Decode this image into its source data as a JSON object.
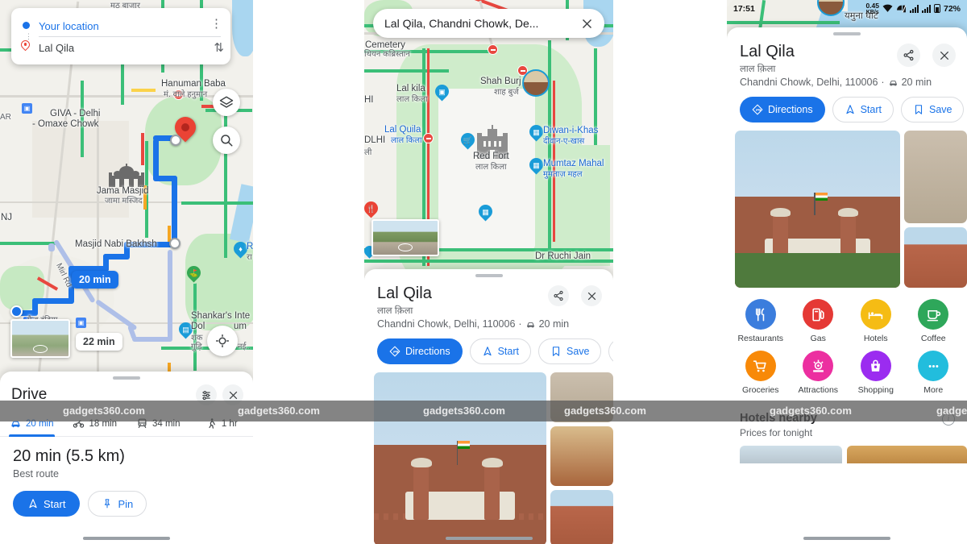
{
  "panel1": {
    "directions_card": {
      "origin": "Your location",
      "destination": "Lal Qila",
      "origin_icon": "blue-dot-icon",
      "destination_icon": "place-pin-icon",
      "menu_icon": "kebab-menu-icon",
      "swap_icon": "swap-vertical-icon"
    },
    "map_labels": [
      {
        "text": "मठ बाजार"
      },
      {
        "text": "Hanuman Baba"
      },
      {
        "text": "मं. वाले हनुमान"
      },
      {
        "text": "GIVA - Delhi"
      },
      {
        "text": "- Omaxe Chowk"
      },
      {
        "text": "Jama Masjid"
      },
      {
        "text": "जामा मस्जिद"
      },
      {
        "text": "Masjid Nabi Bakhsh"
      },
      {
        "text": "NJ"
      },
      {
        "text": "AR"
      },
      {
        "text": "Mirl Rd"
      },
      {
        "text": "फैब इंडिया"
      },
      {
        "text": "Shankar's Inte"
      },
      {
        "text": "Dol"
      },
      {
        "text": "um"
      },
      {
        "text": "शंक"
      },
      {
        "text": "गुड़ि"
      },
      {
        "text": "नई.."
      },
      {
        "text": "R"
      },
      {
        "text": "रा"
      }
    ],
    "route_chips": [
      {
        "label": "20 min",
        "primary": true
      },
      {
        "label": "22 min",
        "primary": false
      }
    ],
    "map_buttons": [
      "layers-icon",
      "search-icon",
      "recenter-icon"
    ],
    "sheet": {
      "title": "Drive",
      "options_icon": "tune-icon",
      "close_icon": "close-icon",
      "modes": [
        {
          "icon": "car-icon",
          "label": "20 min",
          "active": true
        },
        {
          "icon": "motorcycle-icon",
          "label": "18 min",
          "active": false
        },
        {
          "icon": "transit-icon",
          "label": "34 min",
          "active": false
        },
        {
          "icon": "walk-icon",
          "label": "1 hr",
          "active": false
        }
      ],
      "route_headline": "20 min (5.5 km)",
      "route_sub": "Best route",
      "start_label": "Start",
      "pin_label": "Pin"
    }
  },
  "panel2": {
    "search": {
      "value": "Lal Qila, Chandni Chowk, De...",
      "clear_icon": "close-icon"
    },
    "map_labels": [
      {
        "text": "Cemetery"
      },
      {
        "text": "थियन कब्रिस्तान"
      },
      {
        "text": "Lal kila"
      },
      {
        "text": "लाल किला"
      },
      {
        "text": "Shah Burj"
      },
      {
        "text": "शाह बुर्ज"
      },
      {
        "text": "Lal Quila"
      },
      {
        "text": "लाल किला"
      },
      {
        "text": "DLHI"
      },
      {
        "text": "ली"
      },
      {
        "text": "HI"
      },
      {
        "text": "Red Fort"
      },
      {
        "text": "लाल किला"
      },
      {
        "text": "Diwan-i-Khas"
      },
      {
        "text": "दीवान-ए-खास"
      },
      {
        "text": "Mumtaz Mahal"
      },
      {
        "text": "मुमताज़ महल"
      },
      {
        "text": "Dr Ruchi Jain"
      }
    ],
    "sheet": {
      "name": "Lal Qila",
      "name_devanagari": "लाल क़िला",
      "address": "Chandni Chowk, Delhi, 110006",
      "drive_time": "20 min",
      "drive_icon": "car-icon",
      "share_icon": "share-icon",
      "close_icon": "close-icon",
      "actions": [
        {
          "icon": "directions-icon",
          "label": "Directions",
          "primary": true
        },
        {
          "icon": "navigation-icon",
          "label": "Start",
          "primary": false
        },
        {
          "icon": "bookmark-icon",
          "label": "Save",
          "primary": false
        },
        {
          "icon": "share-icon",
          "label": "",
          "primary": false
        }
      ],
      "photos": [
        "red-fort-photo",
        "fort-gallery-photo",
        "bazaar-photo",
        "fort-wall-photo"
      ]
    }
  },
  "panel3": {
    "status_bar": {
      "time": "17:51",
      "data_rate_value": "0.45",
      "data_rate_unit": "KB/s",
      "battery": "72%",
      "icons": [
        "wifi-icon",
        "sim-signal-icon",
        "signal-bars-icon",
        "signal-bars-icon",
        "battery-icon"
      ]
    },
    "map_labels": [
      {
        "text": "यमुना घाट"
      }
    ],
    "sheet": {
      "name": "Lal Qila",
      "name_devanagari": "लाल क़िला",
      "address": "Chandni Chowk, Delhi, 110006",
      "drive_time": "20 min",
      "drive_icon": "car-icon",
      "share_icon": "share-icon",
      "close_icon": "close-icon",
      "actions": [
        {
          "icon": "directions-icon",
          "label": "Directions",
          "primary": true
        },
        {
          "icon": "navigation-icon",
          "label": "Start",
          "primary": false
        },
        {
          "icon": "bookmark-icon",
          "label": "Save",
          "primary": false
        },
        {
          "icon": "share-icon",
          "label": "",
          "primary": false
        }
      ],
      "photos": [
        "red-fort-photo",
        "fort-arch-photo",
        "fort-wall-photo"
      ],
      "categories": [
        {
          "label": "Restaurants",
          "icon": "restaurant-icon",
          "color": "#3b7ddd"
        },
        {
          "label": "Gas",
          "icon": "gas-station-icon",
          "color": "#e53935"
        },
        {
          "label": "Hotels",
          "icon": "hotel-icon",
          "color": "#f5bc14"
        },
        {
          "label": "Coffee",
          "icon": "coffee-icon",
          "color": "#2ea75a"
        },
        {
          "label": "Groceries",
          "icon": "grocery-cart-icon",
          "color": "#f88908"
        },
        {
          "label": "Attractions",
          "icon": "attractions-icon",
          "color": "#ec2fa0"
        },
        {
          "label": "Shopping",
          "icon": "shopping-bag-icon",
          "color": "#9b2cf0"
        },
        {
          "label": "More",
          "icon": "more-dots-icon",
          "color": "#22bddd"
        }
      ],
      "hotels_title": "Hotels nearby",
      "hotels_sub": "Prices for tonight",
      "info_icon": "info-icon"
    }
  },
  "watermark": {
    "text": "gadgets360.com"
  },
  "colors": {
    "google_blue": "#1a73e8",
    "route_blue": "#1a73e8",
    "marker_red": "#ea4335",
    "traffic_green": "#3bbf78",
    "traffic_red": "#e8473f",
    "park_green": "#c6e9c2",
    "water_blue": "#a9d6f0"
  }
}
